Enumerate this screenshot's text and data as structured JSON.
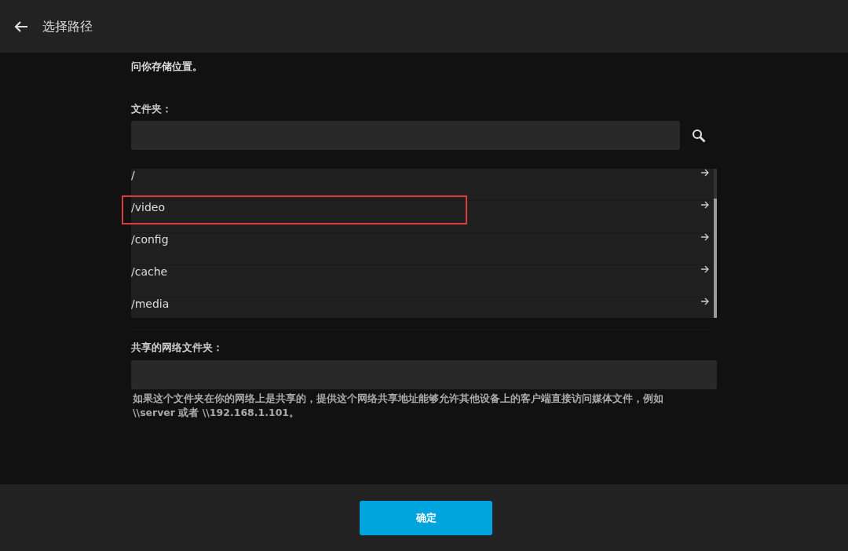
{
  "header": {
    "back_icon": true,
    "title": "选择路径"
  },
  "intro_tail": "问你存储位置。",
  "folder": {
    "label": "文件夹："
  },
  "directories": [
    {
      "path": "/",
      "highlighted": false
    },
    {
      "path": "/video",
      "highlighted": true
    },
    {
      "path": "/config",
      "highlighted": false
    },
    {
      "path": "/cache",
      "highlighted": false
    },
    {
      "path": "/media",
      "highlighted": false
    }
  ],
  "network": {
    "label": "共享的网络文件夹：",
    "help": "如果这个文件夹在你的网络上是共享的，提供这个网络共享地址能够允许其他设备上的客户端直接访问媒体文件，例如 \\\\server 或者 \\\\192.168.1.101。"
  },
  "footer": {
    "confirm": "确定"
  }
}
